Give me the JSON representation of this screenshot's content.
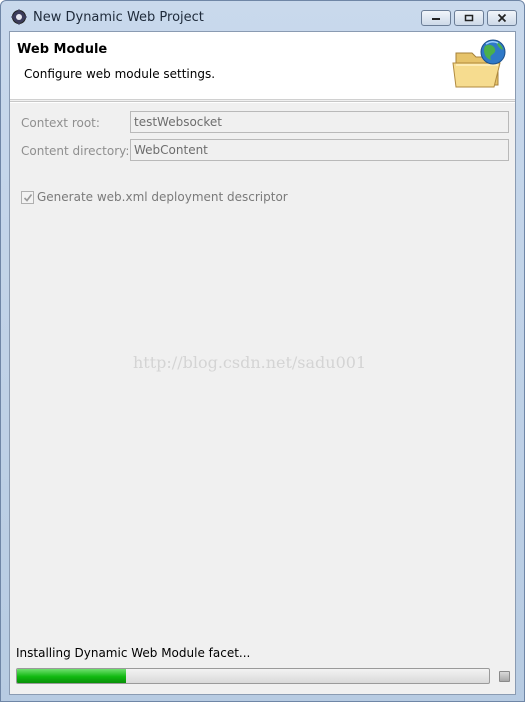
{
  "window": {
    "title": "New Dynamic Web Project"
  },
  "header": {
    "title": "Web Module",
    "description": "Configure web module settings."
  },
  "fields": [
    {
      "label": "Context root:",
      "value": "testWebsocket"
    },
    {
      "label": "Content directory:",
      "value": "WebContent"
    }
  ],
  "options": {
    "generate_descriptor_label": "Generate web.xml deployment descriptor",
    "generate_descriptor_checked": true
  },
  "watermark": "http://blog.csdn.net/sadu001",
  "status": {
    "text": "Installing Dynamic Web Module facet...",
    "progress_fraction": 0.23
  },
  "colors": {
    "progress_green": "#10b910",
    "disabled_text": "#8f8f8f"
  }
}
